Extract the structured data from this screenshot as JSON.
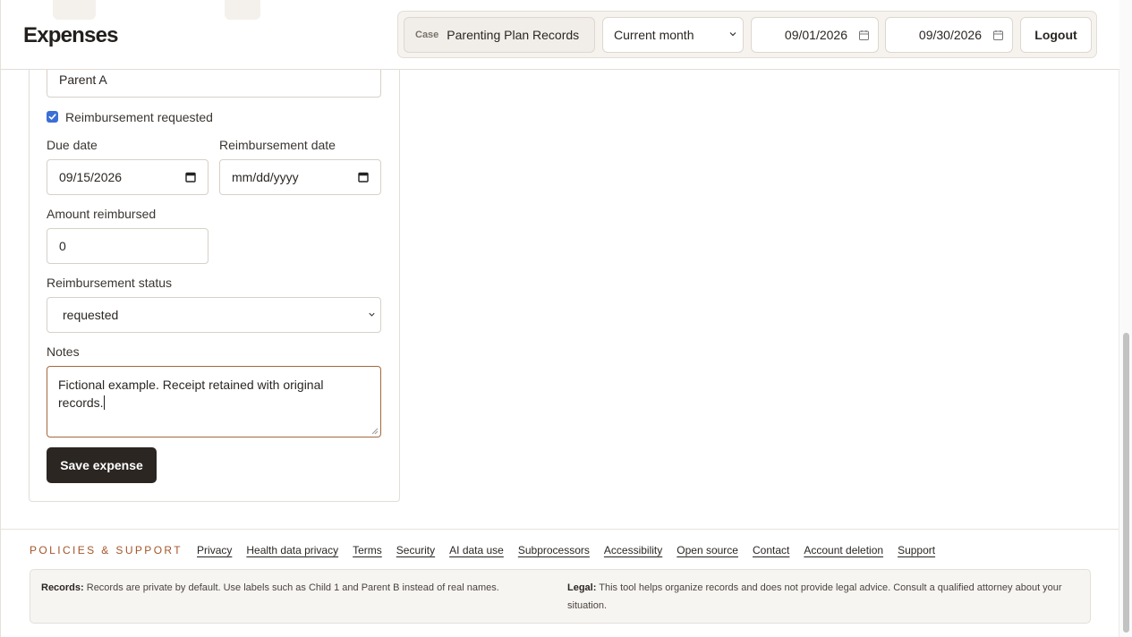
{
  "header": {
    "title": "Expenses",
    "case_label": "Case",
    "case_value": "Parenting Plan Records",
    "period_value": "Current month",
    "date_from": "09/01/2026",
    "date_to": "09/30/2026",
    "logout_label": "Logout"
  },
  "form": {
    "payer_value": "Parent A",
    "reimbursement_requested_label": "Reimbursement requested",
    "reimbursement_requested_checked": true,
    "due_date_label": "Due date",
    "due_date_value": "09/15/2026",
    "reimbursement_date_label": "Reimbursement date",
    "reimbursement_date_placeholder": "mm/dd/yyyy",
    "amount_reimbursed_label": "Amount reimbursed",
    "amount_reimbursed_value": "0",
    "reimbursement_status_label": "Reimbursement status",
    "reimbursement_status_value": "requested",
    "notes_label": "Notes",
    "notes_value": "Fictional example. Receipt retained with original records.",
    "save_label": "Save expense"
  },
  "footer": {
    "heading": "POLICIES & SUPPORT",
    "links": [
      "Privacy",
      "Health data privacy",
      "Terms",
      "Security",
      "AI data use",
      "Subprocessors",
      "Accessibility",
      "Open source",
      "Contact",
      "Account deletion",
      "Support"
    ],
    "records_label": "Records:",
    "records_text": "Records are private by default. Use labels such as Child 1 and Parent B instead of real names.",
    "legal_label": "Legal:",
    "legal_text": "This tool helps organize records and does not provide legal advice. Consult a qualified attorney about your situation."
  },
  "colors": {
    "accent": "#a4552a",
    "button_dark": "#2b2622",
    "checkbox": "#3b6fd6"
  },
  "icons": [
    "calendar-icon",
    "chevron-down-icon",
    "check-icon"
  ]
}
